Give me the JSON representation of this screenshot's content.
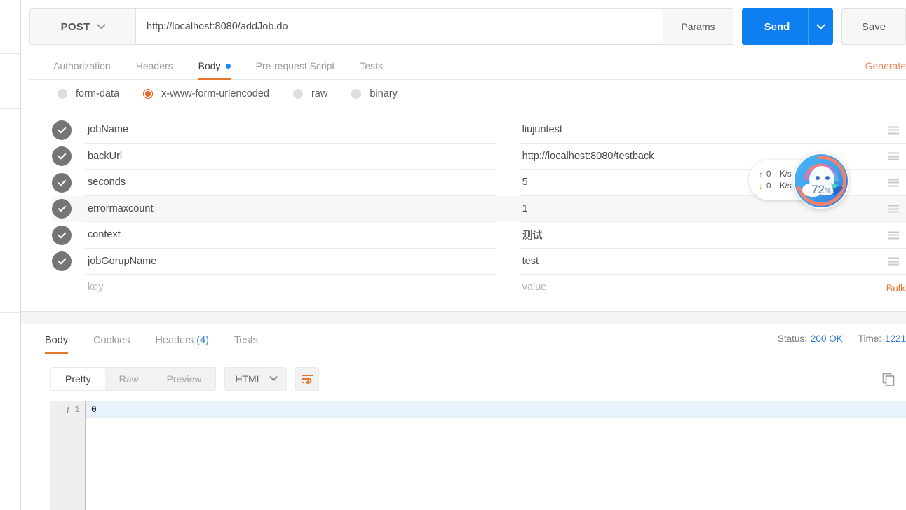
{
  "request": {
    "method": "POST",
    "url": "http://localhost:8080/addJob.do",
    "params_label": "Params",
    "send_label": "Send",
    "save_label": "Save",
    "tabs": [
      {
        "label": "Authorization",
        "active": false,
        "dot": false
      },
      {
        "label": "Headers",
        "active": false,
        "dot": false
      },
      {
        "label": "Body",
        "active": true,
        "dot": true
      },
      {
        "label": "Pre-request Script",
        "active": false,
        "dot": false
      },
      {
        "label": "Tests",
        "active": false,
        "dot": false
      }
    ],
    "generate_label": "Generate",
    "body_types": [
      {
        "label": "form-data",
        "selected": false
      },
      {
        "label": "x-www-form-urlencoded",
        "selected": true
      },
      {
        "label": "raw",
        "selected": false
      },
      {
        "label": "binary",
        "selected": false
      }
    ],
    "bulk_label": "Bulk",
    "key_placeholder": "key",
    "value_placeholder": "value",
    "rows": [
      {
        "key": "jobName",
        "value": "liujuntest",
        "checked": true,
        "hover": false
      },
      {
        "key": "backUrl",
        "value": "http://localhost:8080/testback",
        "checked": true,
        "hover": false
      },
      {
        "key": "seconds",
        "value": "5",
        "checked": true,
        "hover": false
      },
      {
        "key": "errormaxcount",
        "value": "1",
        "checked": true,
        "hover": true
      },
      {
        "key": "context",
        "value": "测试",
        "checked": true,
        "hover": false
      },
      {
        "key": "jobGorupName",
        "value": "test",
        "checked": true,
        "hover": false
      }
    ]
  },
  "response": {
    "tabs": [
      {
        "label": "Body",
        "active": true,
        "count": ""
      },
      {
        "label": "Cookies",
        "active": false,
        "count": ""
      },
      {
        "label": "Headers",
        "active": false,
        "count": "(4)"
      },
      {
        "label": "Tests",
        "active": false,
        "count": ""
      }
    ],
    "status_label": "Status:",
    "status_value": "200 OK",
    "time_label": "Time:",
    "time_value": "1221",
    "view_modes": [
      {
        "label": "Pretty",
        "active": true
      },
      {
        "label": "Raw",
        "active": false
      },
      {
        "label": "Preview",
        "active": false
      }
    ],
    "format": "HTML",
    "line_number": "1",
    "body_text": "0"
  },
  "net_widget": {
    "upload_value": "0",
    "upload_unit": "K/s",
    "download_value": "0",
    "download_unit": "K/s",
    "percent": "72",
    "percent_unit": "%"
  },
  "colors": {
    "accent_orange": "#e8762a",
    "send_blue": "#0d7ff1",
    "link_blue": "#2f7fdb",
    "radio_orange": "#f0611a"
  }
}
